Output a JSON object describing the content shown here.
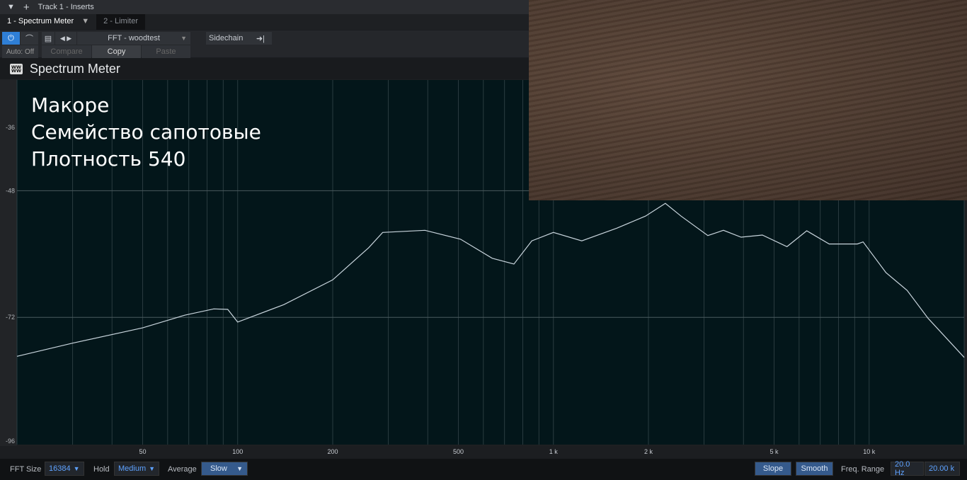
{
  "header": {
    "title": "Track 1 - Inserts",
    "collapse_icon": "triangle-down-icon",
    "add_icon": "plus-icon"
  },
  "tabs": [
    {
      "label": "1 - Spectrum Meter",
      "active": true
    },
    {
      "label": "2 - Limiter",
      "active": false
    }
  ],
  "controls": {
    "auto": "Auto: Off",
    "preset": "FFT - woodtest",
    "compare": "Compare",
    "copy": "Copy",
    "paste": "Paste",
    "sidechain": "Sidechain"
  },
  "plugin": {
    "title": "Spectrum Meter",
    "logo": "PreSonus"
  },
  "overlay": {
    "line1": "Макоре",
    "line2": "Семейство сапотовые",
    "line3": "Плотность 540"
  },
  "footer": {
    "fft_label": "FFT Size",
    "fft_value": "16384",
    "hold_label": "Hold",
    "hold_value": "Medium",
    "avg_label": "Average",
    "avg_value": "Slow",
    "slope": "Slope",
    "smooth": "Smooth",
    "range_label": "Freq. Range",
    "range_min": "20.0 Hz",
    "range_max": "20.00 k"
  },
  "colors": {
    "accent": "#2f7fd6",
    "trace": "#c8d4dc",
    "plot_bg": "#03161a"
  },
  "chart_data": {
    "type": "line",
    "xscale": "log",
    "xlim": [
      20,
      20000
    ],
    "ylim": [
      -96,
      -27
    ],
    "x_ticks": [
      {
        "v": 50,
        "label": "50"
      },
      {
        "v": 100,
        "label": "100"
      },
      {
        "v": 200,
        "label": "200"
      },
      {
        "v": 500,
        "label": "500"
      },
      {
        "v": 1000,
        "label": "1 k"
      },
      {
        "v": 2000,
        "label": "2 k"
      },
      {
        "v": 5000,
        "label": "5 k"
      },
      {
        "v": 10000,
        "label": "10 k"
      }
    ],
    "y_ticks": [
      {
        "v": -36,
        "label": "-36"
      },
      {
        "v": -48,
        "label": "-48"
      },
      {
        "v": -72,
        "label": "-72"
      },
      {
        "v": -96,
        "label": "-96"
      }
    ],
    "y_grid": [
      -48,
      -72
    ],
    "x": [
      20,
      30,
      50,
      68,
      84,
      93,
      100,
      140,
      200,
      260,
      288,
      392,
      508,
      640,
      750,
      854,
      1000,
      1230,
      1588,
      1958,
      2263,
      2536,
      3085,
      3456,
      3931,
      4590,
      5494,
      6343,
      7474,
      9180,
      9570,
      11300,
      13190,
      15380,
      20000
    ],
    "y": [
      -79.4,
      -76.9,
      -74.0,
      -71.6,
      -70.4,
      -70.5,
      -72.9,
      -69.6,
      -64.9,
      -58.8,
      -55.9,
      -55.5,
      -57.2,
      -60.8,
      -61.9,
      -57.5,
      -55.9,
      -57.5,
      -55.1,
      -52.8,
      -50.4,
      -52.8,
      -56.5,
      -55.5,
      -56.8,
      -56.4,
      -58.6,
      -55.6,
      -58.1,
      -58.1,
      -57.7,
      -63.5,
      -66.9,
      -72.2,
      -79.6
    ]
  }
}
